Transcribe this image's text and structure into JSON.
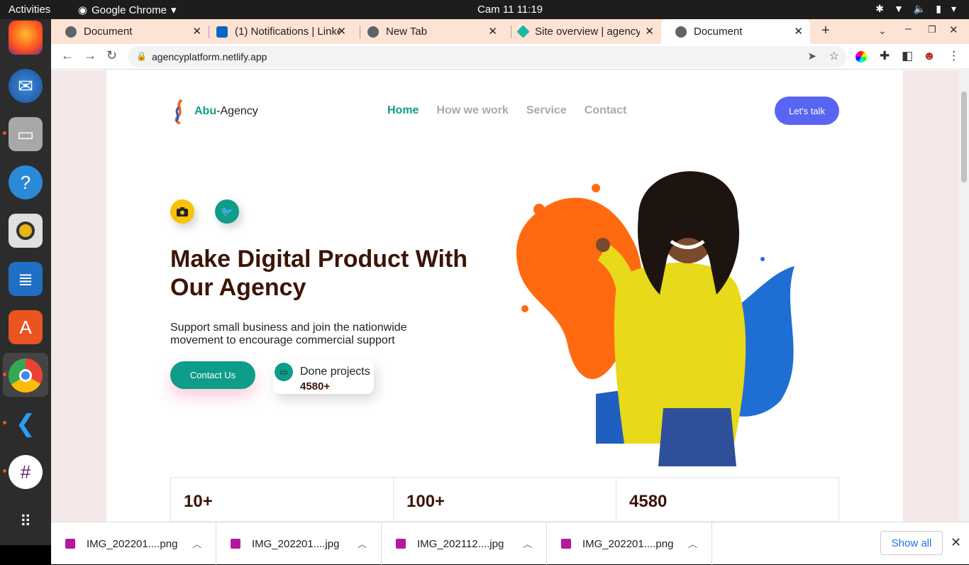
{
  "system": {
    "activities": "Activities",
    "app_name": "Google Chrome",
    "clock": "Cam 11  11:19"
  },
  "tabs": [
    {
      "title": "Document",
      "icon_color": "#5f6368"
    },
    {
      "title": "(1) Notifications | LinkedIn",
      "icon_color": "#0a66c2"
    },
    {
      "title": "New Tab",
      "icon_color": "#5f6368"
    },
    {
      "title": "Site overview | agencyplatform",
      "icon_color": "#1ab7a5"
    },
    {
      "title": "Document",
      "icon_color": "#5f6368"
    }
  ],
  "toolbar": {
    "url": "agencyplatform.netlify.app"
  },
  "site": {
    "brand_accent": "Abu",
    "brand_rest": "-Agency",
    "nav": [
      "Home",
      "How we work",
      "Service",
      "Contact"
    ],
    "cta": "Let's talk",
    "hero_title": "Make Digital Product With Our Agency",
    "hero_sub": "Support small business and join the nationwide movement to encourage commercial support",
    "contact_btn": "Contact Us",
    "done_label": "Done projects",
    "done_value": "4580+",
    "stats": [
      "10+",
      "100+",
      "4580"
    ],
    "accent_color": "#0e9d8a",
    "cta_color": "#5865f2"
  },
  "downloads": {
    "items": [
      "IMG_202201....png",
      "IMG_202201....jpg",
      "IMG_202112....jpg",
      "IMG_202201....png"
    ],
    "show_all": "Show all"
  }
}
